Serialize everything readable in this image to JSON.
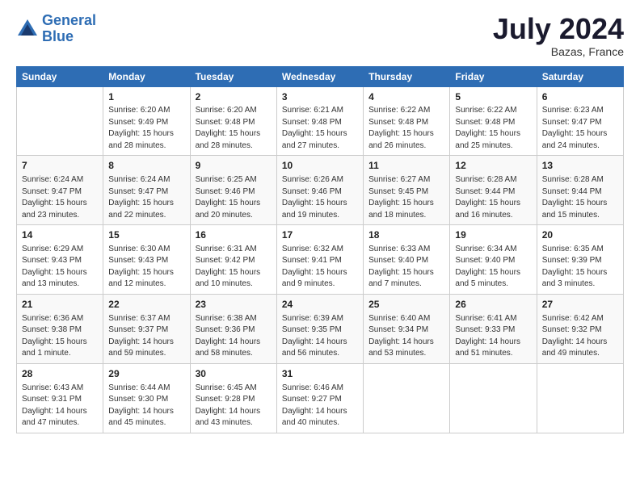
{
  "logo": {
    "line1": "General",
    "line2": "Blue"
  },
  "title": "July 2024",
  "subtitle": "Bazas, France",
  "days_header": [
    "Sunday",
    "Monday",
    "Tuesday",
    "Wednesday",
    "Thursday",
    "Friday",
    "Saturday"
  ],
  "weeks": [
    [
      {
        "day": "",
        "info": ""
      },
      {
        "day": "1",
        "info": "Sunrise: 6:20 AM\nSunset: 9:49 PM\nDaylight: 15 hours\nand 28 minutes."
      },
      {
        "day": "2",
        "info": "Sunrise: 6:20 AM\nSunset: 9:48 PM\nDaylight: 15 hours\nand 28 minutes."
      },
      {
        "day": "3",
        "info": "Sunrise: 6:21 AM\nSunset: 9:48 PM\nDaylight: 15 hours\nand 27 minutes."
      },
      {
        "day": "4",
        "info": "Sunrise: 6:22 AM\nSunset: 9:48 PM\nDaylight: 15 hours\nand 26 minutes."
      },
      {
        "day": "5",
        "info": "Sunrise: 6:22 AM\nSunset: 9:48 PM\nDaylight: 15 hours\nand 25 minutes."
      },
      {
        "day": "6",
        "info": "Sunrise: 6:23 AM\nSunset: 9:47 PM\nDaylight: 15 hours\nand 24 minutes."
      }
    ],
    [
      {
        "day": "7",
        "info": "Sunrise: 6:24 AM\nSunset: 9:47 PM\nDaylight: 15 hours\nand 23 minutes."
      },
      {
        "day": "8",
        "info": "Sunrise: 6:24 AM\nSunset: 9:47 PM\nDaylight: 15 hours\nand 22 minutes."
      },
      {
        "day": "9",
        "info": "Sunrise: 6:25 AM\nSunset: 9:46 PM\nDaylight: 15 hours\nand 20 minutes."
      },
      {
        "day": "10",
        "info": "Sunrise: 6:26 AM\nSunset: 9:46 PM\nDaylight: 15 hours\nand 19 minutes."
      },
      {
        "day": "11",
        "info": "Sunrise: 6:27 AM\nSunset: 9:45 PM\nDaylight: 15 hours\nand 18 minutes."
      },
      {
        "day": "12",
        "info": "Sunrise: 6:28 AM\nSunset: 9:44 PM\nDaylight: 15 hours\nand 16 minutes."
      },
      {
        "day": "13",
        "info": "Sunrise: 6:28 AM\nSunset: 9:44 PM\nDaylight: 15 hours\nand 15 minutes."
      }
    ],
    [
      {
        "day": "14",
        "info": "Sunrise: 6:29 AM\nSunset: 9:43 PM\nDaylight: 15 hours\nand 13 minutes."
      },
      {
        "day": "15",
        "info": "Sunrise: 6:30 AM\nSunset: 9:43 PM\nDaylight: 15 hours\nand 12 minutes."
      },
      {
        "day": "16",
        "info": "Sunrise: 6:31 AM\nSunset: 9:42 PM\nDaylight: 15 hours\nand 10 minutes."
      },
      {
        "day": "17",
        "info": "Sunrise: 6:32 AM\nSunset: 9:41 PM\nDaylight: 15 hours\nand 9 minutes."
      },
      {
        "day": "18",
        "info": "Sunrise: 6:33 AM\nSunset: 9:40 PM\nDaylight: 15 hours\nand 7 minutes."
      },
      {
        "day": "19",
        "info": "Sunrise: 6:34 AM\nSunset: 9:40 PM\nDaylight: 15 hours\nand 5 minutes."
      },
      {
        "day": "20",
        "info": "Sunrise: 6:35 AM\nSunset: 9:39 PM\nDaylight: 15 hours\nand 3 minutes."
      }
    ],
    [
      {
        "day": "21",
        "info": "Sunrise: 6:36 AM\nSunset: 9:38 PM\nDaylight: 15 hours\nand 1 minute."
      },
      {
        "day": "22",
        "info": "Sunrise: 6:37 AM\nSunset: 9:37 PM\nDaylight: 14 hours\nand 59 minutes."
      },
      {
        "day": "23",
        "info": "Sunrise: 6:38 AM\nSunset: 9:36 PM\nDaylight: 14 hours\nand 58 minutes."
      },
      {
        "day": "24",
        "info": "Sunrise: 6:39 AM\nSunset: 9:35 PM\nDaylight: 14 hours\nand 56 minutes."
      },
      {
        "day": "25",
        "info": "Sunrise: 6:40 AM\nSunset: 9:34 PM\nDaylight: 14 hours\nand 53 minutes."
      },
      {
        "day": "26",
        "info": "Sunrise: 6:41 AM\nSunset: 9:33 PM\nDaylight: 14 hours\nand 51 minutes."
      },
      {
        "day": "27",
        "info": "Sunrise: 6:42 AM\nSunset: 9:32 PM\nDaylight: 14 hours\nand 49 minutes."
      }
    ],
    [
      {
        "day": "28",
        "info": "Sunrise: 6:43 AM\nSunset: 9:31 PM\nDaylight: 14 hours\nand 47 minutes."
      },
      {
        "day": "29",
        "info": "Sunrise: 6:44 AM\nSunset: 9:30 PM\nDaylight: 14 hours\nand 45 minutes."
      },
      {
        "day": "30",
        "info": "Sunrise: 6:45 AM\nSunset: 9:28 PM\nDaylight: 14 hours\nand 43 minutes."
      },
      {
        "day": "31",
        "info": "Sunrise: 6:46 AM\nSunset: 9:27 PM\nDaylight: 14 hours\nand 40 minutes."
      },
      {
        "day": "",
        "info": ""
      },
      {
        "day": "",
        "info": ""
      },
      {
        "day": "",
        "info": ""
      }
    ]
  ]
}
